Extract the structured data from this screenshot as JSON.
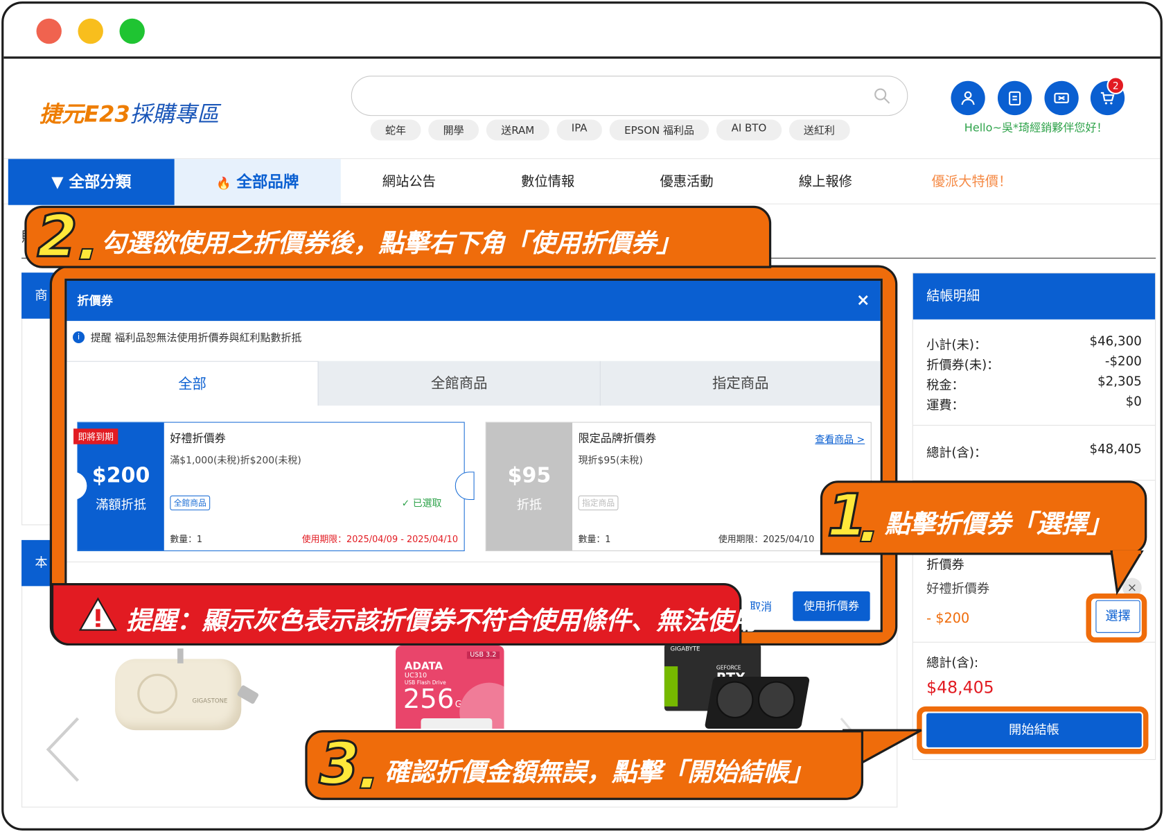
{
  "header": {
    "logo_part1": "捷元",
    "logo_part2": "E23",
    "logo_part3": "採購專區",
    "search_placeholder": "",
    "hot_tags": [
      "蛇年",
      "開學",
      "送RAM",
      "IPA",
      "EPSON 福利品",
      "AI BTO",
      "送紅利"
    ],
    "cart_count": "2",
    "greeting": "Hello~吳*琦經銷夥伴您好！"
  },
  "nav": {
    "all_categories": "▼ 全部分類",
    "all_brands": "全部品牌",
    "items": [
      "網站公告",
      "數位情報",
      "優惠活動",
      "線上報修"
    ],
    "promo": "優派大特價！"
  },
  "background": {
    "cart_title_partial": "購",
    "products_header_partial": "商",
    "recommend_header_partial": "本"
  },
  "summary": {
    "title": "結帳明細",
    "lines": [
      {
        "label": "小計(未)：",
        "value": "$46,300"
      },
      {
        "label": "折價券(未)：",
        "value": "-$200"
      },
      {
        "label": "稅金：",
        "value": "$2,305"
      },
      {
        "label": "運費：",
        "value": "$0"
      }
    ],
    "total_label": "總計(含)：",
    "total_value": "$48,405",
    "coupon_section_label": "折價券",
    "coupon_selected_name": "好禮折價券",
    "coupon_discount": "-  $200",
    "choose_button": "選擇",
    "final_total_label": "總計(含):",
    "final_total_value": "$48,405",
    "checkout_button": "開始結帳"
  },
  "modal": {
    "title": "折價券",
    "close": "×",
    "notice": "提醒 福利品恕無法使用折價券與紅利點數折抵",
    "tabs": [
      "全部",
      "全館商品",
      "指定商品"
    ],
    "coupons": [
      {
        "ribbon": "即將到期",
        "amount": "$200",
        "type": "滿額折抵",
        "name": "好禮折價券",
        "condition": "滿$1,000(未稅)折$200(未稅)",
        "chip": "全館商品",
        "status": "✓ 已選取",
        "qty": "數量：1",
        "period": "使用期限：2025/04/09 - 2025/04/10"
      },
      {
        "amount": "$95",
        "type": "折抵",
        "name": "限定品牌折價券",
        "condition": "現折$95(未稅)",
        "chip": "指定商品",
        "link": "查看商品 >",
        "qty": "數量：1",
        "period": "使用期限：2025/04/10"
      }
    ],
    "cancel_button": "取消",
    "apply_button": "使用折價券"
  },
  "callouts": {
    "step1_num": "1",
    "step1_text": "點擊折價券「選擇」",
    "step2_num": "2",
    "step2_text": "勾選欲使用之折價券後，點擊右下角「使用折價券」",
    "step3_num": "3",
    "step3_text": "確認折價金額無誤，點擊「開始結帳」",
    "warning_text": "提醒：顯示灰色表示該折價券不符合使用條件、無法使用"
  },
  "products": {
    "usb_brand": "ADATA",
    "usb_model": "UC310",
    "usb_desc": "USB Flash Drive",
    "usb_capacity": "256",
    "usb_unit": "GB",
    "usb_spec": "USB 3.2",
    "gpu_brand": "GIGABYTE",
    "gpu_model": "RTX",
    "gpu_series": "GEFORCE",
    "charger_brand": "GIGASTONE"
  },
  "colors": {
    "primary_blue": "#0a5fd1",
    "callout_orange": "#ef6c0b",
    "accent_yellow": "#ffe83a",
    "warning_red": "#e21b22",
    "greeting_green": "#2fa34b"
  }
}
